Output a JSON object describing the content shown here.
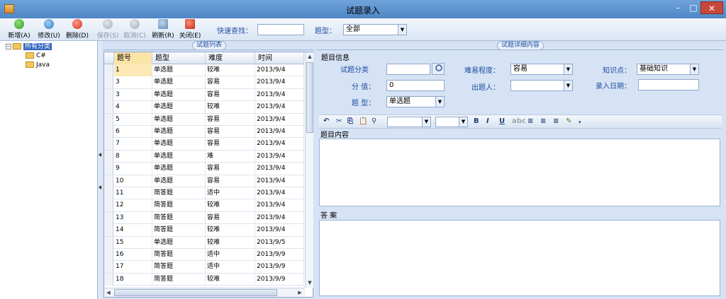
{
  "window": {
    "title": "试题录入",
    "min": "–",
    "max": "□",
    "close": "✕"
  },
  "toolbar": {
    "buttons": [
      {
        "label": "新增(A)",
        "icon": "add-icon"
      },
      {
        "label": "修改(U)",
        "icon": "edit-icon"
      },
      {
        "label": "删除(D)",
        "icon": "delete-icon"
      },
      {
        "label": "保存(S)",
        "icon": "save-icon"
      },
      {
        "label": "取消(C)",
        "icon": "cancel-icon"
      },
      {
        "label": "刷新(R)",
        "icon": "refresh-icon"
      },
      {
        "label": "关闭(E)",
        "icon": "close-icon"
      }
    ],
    "quick_search_label": "快速查找：",
    "quick_search_value": "",
    "type_label": "题型：",
    "type_value": "全部"
  },
  "tree": {
    "root": "所有分类",
    "children": [
      "C#",
      "Java"
    ]
  },
  "list": {
    "group_title": "试题列表",
    "columns": [
      "题号",
      "题型",
      "难度",
      "时间"
    ],
    "rows": [
      [
        "1",
        "单选题",
        "较难",
        "2013/9/4"
      ],
      [
        "3",
        "单选题",
        "容易",
        "2013/9/4"
      ],
      [
        "3",
        "单选题",
        "容易",
        "2013/9/4"
      ],
      [
        "4",
        "单选题",
        "较难",
        "2013/9/4"
      ],
      [
        "5",
        "单选题",
        "容易",
        "2013/9/4"
      ],
      [
        "6",
        "单选题",
        "容易",
        "2013/9/4"
      ],
      [
        "7",
        "单选题",
        "容易",
        "2013/9/4"
      ],
      [
        "8",
        "单选题",
        "难",
        "2013/9/4"
      ],
      [
        "9",
        "单选题",
        "容易",
        "2013/9/4"
      ],
      [
        "10",
        "单选题",
        "容易",
        "2013/9/4"
      ],
      [
        "11",
        "简答题",
        "适中",
        "2013/9/4"
      ],
      [
        "12",
        "简答题",
        "较难",
        "2013/9/4"
      ],
      [
        "13",
        "简答题",
        "容易",
        "2013/9/4"
      ],
      [
        "14",
        "简答题",
        "较难",
        "2013/9/4"
      ],
      [
        "15",
        "单选题",
        "较难",
        "2013/9/5"
      ],
      [
        "16",
        "简答题",
        "适中",
        "2013/9/9"
      ],
      [
        "17",
        "简答题",
        "适中",
        "2013/9/9"
      ],
      [
        "18",
        "简答题",
        "较难",
        "2013/9/9"
      ]
    ]
  },
  "detail": {
    "group_title": "试题详细内容",
    "info_label": "题目信息",
    "category_label": "试题分类",
    "category_value": "",
    "difficulty_label": "难易程度：",
    "difficulty_value": "容易",
    "knowledge_label": "知识点：",
    "knowledge_value": "基础知识",
    "score_label": "分 值：",
    "score_value": "0",
    "author_label": "出题人：",
    "author_value": "",
    "date_label": "录入日期：",
    "date_value": "",
    "qtype_label": "题 型：",
    "qtype_value": "单选题",
    "content_label": "题目内容",
    "answer_label": "答 案"
  },
  "editor": {
    "bold": "B",
    "italic": "I",
    "underline": "U"
  }
}
